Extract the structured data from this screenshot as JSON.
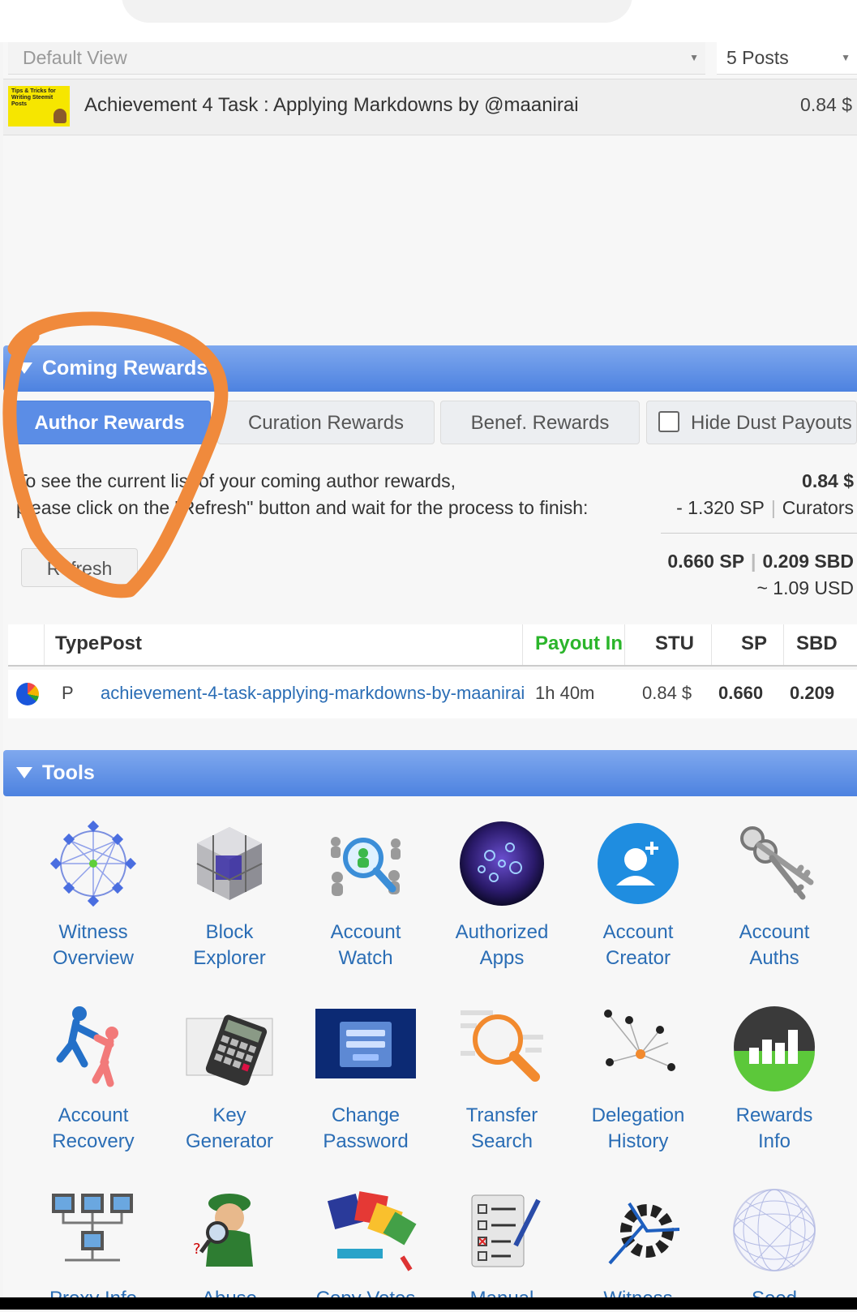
{
  "filters": {
    "view": "Default View",
    "posts": "5 Posts"
  },
  "top_post": {
    "title": "Achievement 4 Task : Applying Markdowns by @maanirai",
    "value": "0.84 $",
    "thumb_text": "Tips & Tricks for Writing Steemit Posts"
  },
  "rewards": {
    "title": "Coming Rewards",
    "tabs": [
      "Author Rewards",
      "Curation Rewards",
      "Benef. Rewards"
    ],
    "hide_dust": "Hide Dust Payouts",
    "info_line1": "To see the current list of your coming author rewards,",
    "info_line2": "please click on the \"Refresh\" button and wait for the process to finish:",
    "refresh": "Refresh",
    "sum_usd": "0.84 $",
    "sum_sp": "- 1.320 SP",
    "sum_curators": "Curators",
    "total_sp": "0.660 SP",
    "total_sbd": "0.209 SBD",
    "approx_usd": "~ 1.09 USD"
  },
  "table": {
    "headers": [
      "Type",
      "Post",
      "Payout In",
      "STU",
      "SP",
      "SBD"
    ],
    "rows": [
      {
        "type": "P",
        "post": "achievement-4-task-applying-markdowns-by-maanirai",
        "payout_in": "1h 40m",
        "stu": "0.84 $",
        "sp": "0.660",
        "sbd": "0.209"
      }
    ]
  },
  "tools": {
    "title": "Tools",
    "items": [
      [
        "Witness",
        "Overview"
      ],
      [
        "Block",
        "Explorer"
      ],
      [
        "Account",
        "Watch"
      ],
      [
        "Authorized",
        "Apps"
      ],
      [
        "Account",
        "Creator"
      ],
      [
        "Account",
        "Auths"
      ],
      [
        "Account",
        "Recovery"
      ],
      [
        "Key",
        "Generator"
      ],
      [
        "Change",
        "Password"
      ],
      [
        "Transfer",
        "Search"
      ],
      [
        "Delegation",
        "History"
      ],
      [
        "Rewards",
        "Info"
      ],
      [
        "Proxy Info",
        ""
      ],
      [
        "Abuse",
        ""
      ],
      [
        "Copy Votes",
        ""
      ],
      [
        "Manual",
        ""
      ],
      [
        "Witness",
        ""
      ],
      [
        "Seed",
        ""
      ]
    ]
  },
  "colors": {
    "header_blue": "#5b8de6",
    "link_blue": "#2a6db5",
    "payout_green": "#2bb52b",
    "annotation_orange": "#f08a3c"
  }
}
